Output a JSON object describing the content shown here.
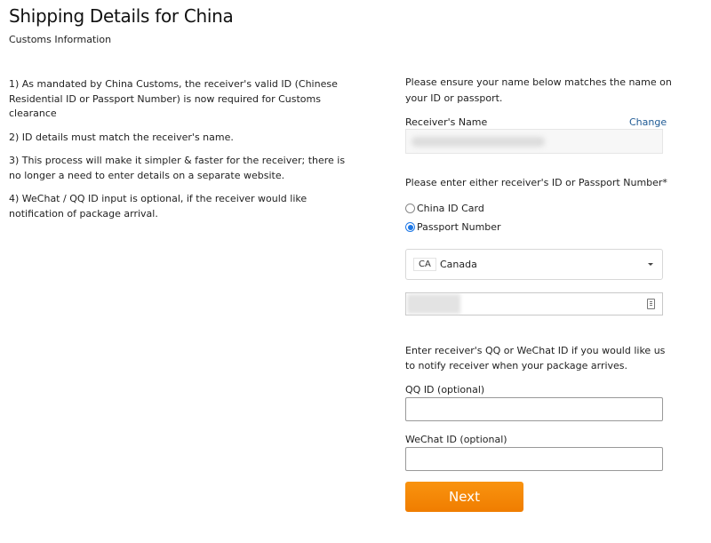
{
  "header": {
    "title": "Shipping Details for China",
    "subtitle": "Customs Information"
  },
  "info": [
    "1) As mandated by China Customs, the receiver's valid ID (Chinese Residential ID or Passport Number) is now required for Customs clearance",
    "2) ID details must match the receiver's name.",
    "3) This process will make it simpler & faster for the receiver; there is no longer a need to enter details on a separate website.",
    "4) WeChat / QQ ID input is optional, if the receiver would like notification of package arrival."
  ],
  "form": {
    "intro": "Please ensure your name below matches the name on your ID or passport.",
    "receiver_name_label": "Receiver's Name",
    "change_link": "Change",
    "id_prompt": "Please enter either receiver's ID or Passport Number*",
    "id_options": [
      {
        "label": "China ID Card",
        "checked": false
      },
      {
        "label": "Passport Number",
        "checked": true
      }
    ],
    "country": {
      "code": "CA",
      "name": "Canada"
    },
    "notify_text": "Enter receiver's QQ or WeChat ID if you would like us to notify receiver when your package arrives.",
    "qq_label": "QQ ID (optional)",
    "qq_value": "",
    "wechat_label": "WeChat ID (optional)",
    "wechat_value": "",
    "next_button": "Next"
  },
  "colors": {
    "accent": "#f28a05",
    "link": "#1e5a94",
    "radio_selected": "#1e78e6"
  }
}
